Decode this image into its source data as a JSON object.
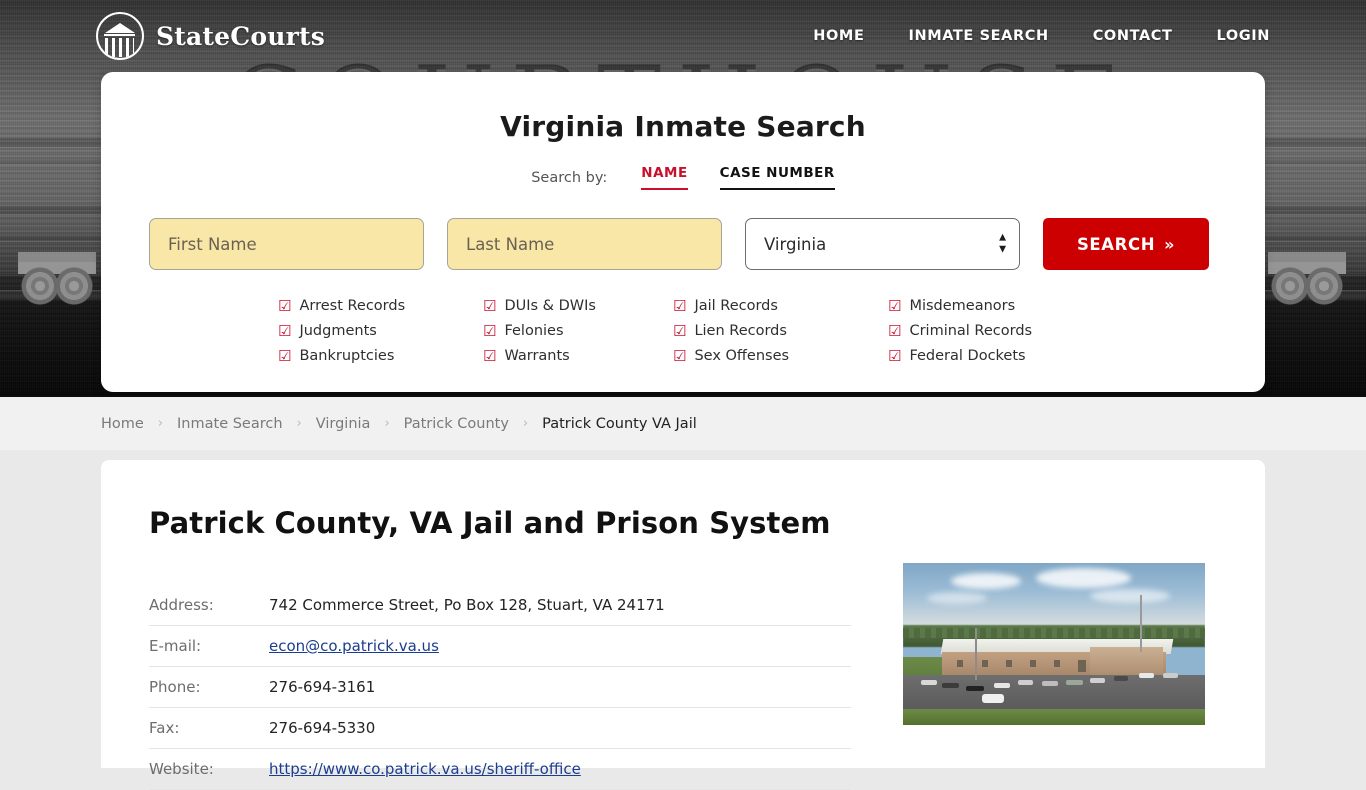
{
  "header": {
    "brand_name": "StateCourts",
    "brand_icon": "courthouse-circle-icon",
    "nav": [
      {
        "label": "HOME"
      },
      {
        "label": "INMATE SEARCH"
      },
      {
        "label": "CONTACT"
      },
      {
        "label": "LOGIN"
      }
    ],
    "background_word": "COURTHOUSE"
  },
  "search": {
    "title": "Virginia Inmate Search",
    "search_by_label": "Search by:",
    "tabs": [
      {
        "label": "NAME",
        "active": true
      },
      {
        "label": "CASE NUMBER",
        "active": false
      }
    ],
    "first_name_placeholder": "First Name",
    "first_name_value": "",
    "last_name_placeholder": "Last Name",
    "last_name_value": "",
    "state_value": "Virginia",
    "state_options": [
      "Virginia"
    ],
    "button_label": "SEARCH",
    "button_chevron": "»",
    "checkbox_glyph": "☑",
    "features": [
      "Arrest Records",
      "DUIs & DWIs",
      "Jail Records",
      "Misdemeanors",
      "Judgments",
      "Felonies",
      "Lien Records",
      "Criminal Records",
      "Bankruptcies",
      "Warrants",
      "Sex Offenses",
      "Federal Dockets"
    ]
  },
  "breadcrumb": {
    "separator": "›",
    "items": [
      {
        "label": "Home",
        "current": false
      },
      {
        "label": "Inmate Search",
        "current": false
      },
      {
        "label": "Virginia",
        "current": false
      },
      {
        "label": "Patrick County",
        "current": false
      },
      {
        "label": "Patrick County VA Jail",
        "current": true
      }
    ]
  },
  "main": {
    "page_title": "Patrick County, VA Jail and Prison System",
    "details": [
      {
        "key": "Address:",
        "value": "742 Commerce Street, Po Box 128, Stuart, VA 24171",
        "link": false
      },
      {
        "key": "E-mail:",
        "value": "econ@co.patrick.va.us",
        "link": true
      },
      {
        "key": "Phone:",
        "value": "276-694-3161",
        "link": false
      },
      {
        "key": "Fax:",
        "value": "276-694-5330",
        "link": false
      },
      {
        "key": "Website:",
        "value": "https://www.co.patrick.va.us/sheriff-office",
        "link": true
      }
    ],
    "photo_alt": "Aerial photo of Patrick County VA Jail facility"
  },
  "colors": {
    "accent_red": "#cc0000",
    "tab_red": "#c8102e",
    "input_yellow": "#f8e7a6",
    "link_blue": "#1b3d8f",
    "page_bg": "#e9e9e9",
    "breadcrumb_bg": "#f1f1f1"
  }
}
